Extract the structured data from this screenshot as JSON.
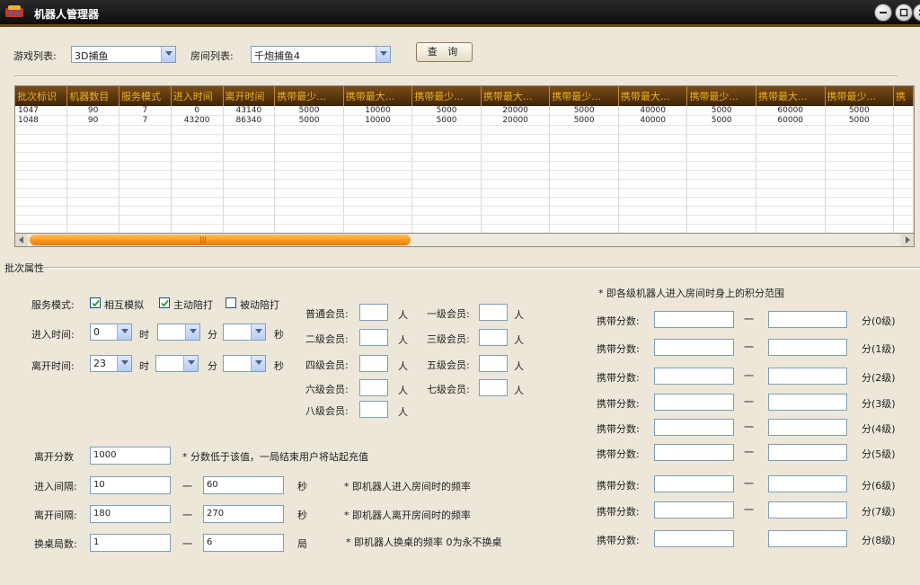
{
  "window": {
    "title": "机器人管理器"
  },
  "filters": {
    "game_label": "游戏列表:",
    "game_value": "3D捕鱼",
    "room_label": "房间列表:",
    "room_value": "千炮捕鱼4",
    "query_label": "查 询"
  },
  "grid": {
    "columns": [
      "批次标识",
      "机器数目",
      "服务模式",
      "进入时间",
      "离开时间",
      "携带最少...",
      "携带最大...",
      "携带最少...",
      "携带最大...",
      "携带最少...",
      "携带最大...",
      "携带最少...",
      "携带最大...",
      "携带最少...",
      "携"
    ],
    "rows": [
      [
        "1047",
        "90",
        "7",
        "0",
        "43140",
        "5000",
        "10000",
        "5000",
        "20000",
        "5000",
        "40000",
        "5000",
        "60000",
        "5000",
        ""
      ],
      [
        "1048",
        "90",
        "7",
        "43200",
        "86340",
        "5000",
        "10000",
        "5000",
        "20000",
        "5000",
        "40000",
        "5000",
        "60000",
        "5000",
        ""
      ]
    ],
    "scroll_grip": "|||"
  },
  "batch": {
    "section_label": "批次属性",
    "service_mode_label": "服务模式:",
    "mode_options": [
      {
        "label": "相互模拟",
        "checked": true
      },
      {
        "label": "主动陪打",
        "checked": true
      },
      {
        "label": "被动陪打",
        "checked": false
      }
    ],
    "enter_time_label": "进入时间:",
    "enter_hour": "0",
    "leave_time_label": "离开时间:",
    "leave_hour": "23",
    "unit_hour": "时",
    "unit_min": "分",
    "unit_sec": "秒",
    "leave_score_label": "离开分数",
    "leave_score_value": "1000",
    "leave_score_note": "* 分数低于该值，一局结束用户将站起充值",
    "enter_interval_label": "进入间隔:",
    "enter_interval_min": "10",
    "enter_interval_max": "60",
    "enter_interval_unit": "秒",
    "enter_interval_note": "* 即机器人进入房间时的频率",
    "leave_interval_label": "离开间隔:",
    "leave_interval_min": "180",
    "leave_interval_max": "270",
    "leave_interval_unit": "秒",
    "leave_interval_note": "* 即机器人离开房间时的频率",
    "swap_label": "换桌局数:",
    "swap_min": "1",
    "swap_max": "6",
    "swap_unit": "局",
    "swap_note": "* 即机器人换桌的频率 0为永不换桌",
    "dash": "一"
  },
  "members": {
    "person_unit": "人",
    "left": [
      "普通会员:",
      "二级会员:",
      "四级会员:",
      "六级会员:",
      "八级会员:"
    ],
    "right": [
      "一级会员:",
      "三级会员:",
      "五级会员:",
      "七级会员:"
    ]
  },
  "score_range": {
    "note": "* 即各级机器人进入房间时身上的积分范围",
    "row_label": "携带分数:",
    "dash": "一",
    "levels": [
      "分(0级)",
      "分(1级)",
      "分(2级)",
      "分(3级)",
      "分(4级)",
      "分(5级)",
      "分(6级)",
      "分(7级)",
      "分(8级)"
    ]
  },
  "colors": {
    "header_text": "#f0b020",
    "scroll_thumb": "#f07a00",
    "titlebar": "#1a1a1a"
  }
}
